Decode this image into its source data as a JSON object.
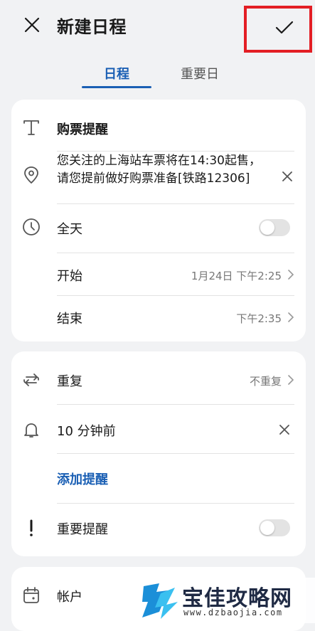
{
  "header": {
    "title": "新建日程"
  },
  "tabs": [
    {
      "label": "日程"
    },
    {
      "label": "重要日"
    }
  ],
  "event": {
    "title": "购票提醒",
    "location": "您关注的上海站车票将在14:30起售，请您提前做好购票准备[铁路12306]",
    "all_day_label": "全天",
    "start_label": "开始",
    "start_value": "1月24日 下午2:25",
    "end_label": "结束",
    "end_value": "下午2:35"
  },
  "reminders": {
    "repeat_label": "重复",
    "repeat_value": "不重复",
    "reminder_value": "10 分钟前",
    "add_label": "添加提醒",
    "important_label": "重要提醒"
  },
  "account": {
    "label": "帐户"
  },
  "watermark": {
    "title": "宝佳攻略网",
    "url": "www.dzbaojia.com"
  },
  "colors": {
    "accent": "#1a5fb4",
    "highlight_box": "#e31e24"
  }
}
